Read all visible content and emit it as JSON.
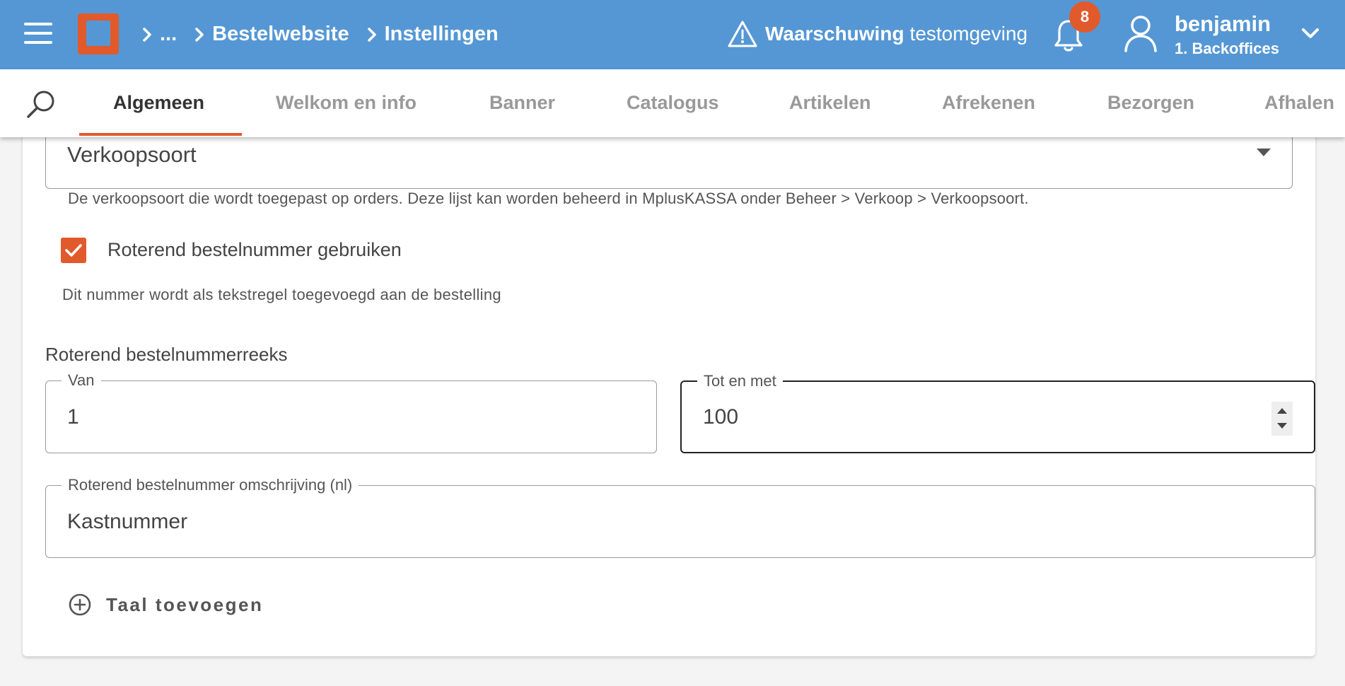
{
  "header": {
    "breadcrumbs": [
      "...",
      "Bestelwebsite",
      "Instellingen"
    ],
    "warning_bold": "Waarschuwing",
    "warning_text": "testomgeving",
    "notification_count": "8",
    "user_name": "benjamin",
    "user_org": "1. Backoffices"
  },
  "tabs": [
    {
      "label": "Algemeen",
      "active": true
    },
    {
      "label": "Welkom en info"
    },
    {
      "label": "Banner"
    },
    {
      "label": "Catalogus"
    },
    {
      "label": "Artikelen"
    },
    {
      "label": "Afrekenen"
    },
    {
      "label": "Bezorgen"
    },
    {
      "label": "Afhalen"
    }
  ],
  "form": {
    "verkoopsoort_value": "Verkoopsoort",
    "verkoopsoort_help": "De verkoopsoort die wordt toegepast op orders. Deze lijst kan worden beheerd in MplusKASSA onder Beheer > Verkoop > Verkoopsoort.",
    "rotating_checkbox_label": "Roterend bestelnummer gebruiken",
    "rotating_checkbox_checked": true,
    "rotating_help": "Dit nummer wordt als tekstregel toegevoegd aan de bestelling",
    "range_label": "Roterend bestelnummerreeks",
    "from_legend": "Van",
    "from_value": "1",
    "to_legend": "Tot en met",
    "to_value": "100",
    "description_legend": "Roterend bestelnummer omschrijving (nl)",
    "description_value": "Kastnummer",
    "add_language_label": "Taal toevoegen"
  },
  "colors": {
    "header_bg": "#5597d4",
    "accent": "#e15a2c"
  },
  "icons": {
    "menu": "hamburger-icon",
    "logo": "app-logo",
    "warning": "warning-triangle-icon",
    "notifications": "bell-icon",
    "user": "user-icon",
    "user_menu": "chevron-down-icon",
    "search": "search-icon",
    "add_language": "plus-circle-icon"
  }
}
